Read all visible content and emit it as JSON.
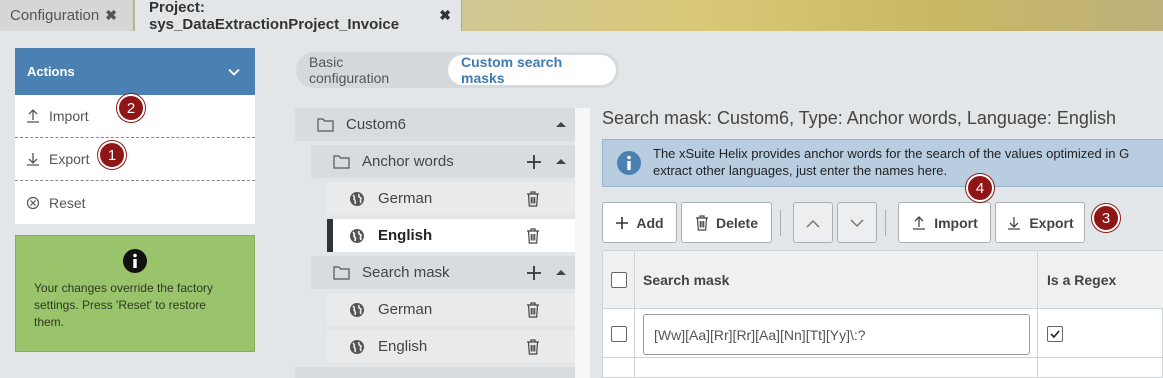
{
  "tabs": [
    {
      "label": "Configuration",
      "close": "✖"
    },
    {
      "label": "Project: sys_DataExtractionProject_Invoice",
      "close": "✖"
    }
  ],
  "actions": {
    "header": "Actions",
    "items": [
      {
        "label": "Import",
        "icon": "upload-icon",
        "badge": "2"
      },
      {
        "label": "Export",
        "icon": "download-icon",
        "badge": "1"
      },
      {
        "label": "Reset",
        "icon": "reset-icon"
      }
    ],
    "info_text": "Your changes override the factory settings. Press 'Reset' to restore them."
  },
  "mode_tabs": [
    {
      "label": "Basic configuration",
      "active": false
    },
    {
      "label": "Custom search masks",
      "active": true
    }
  ],
  "tree": {
    "root": "Custom6",
    "groups": [
      {
        "label": "Anchor words",
        "children": [
          "German",
          "English"
        ]
      },
      {
        "label": "Search mask",
        "children": [
          "German",
          "English"
        ]
      }
    ]
  },
  "main": {
    "title": "Search mask: Custom6, Type: Anchor words, Language: English",
    "info_line1": "The xSuite Helix provides anchor words for the search of the values optimized in G",
    "info_line2": "extract other languages, just enter the names here.",
    "toolbar": {
      "add": "Add",
      "delete": "Delete",
      "import": "Import",
      "export": "Export",
      "import_badge": "4",
      "export_badge": "3"
    },
    "grid": {
      "columns": [
        "Search mask",
        "Is a Regex"
      ],
      "rows": [
        {
          "search_mask": "[Ww][Aa][Rr][Rr][Aa][Nn][Tt][Yy]\\:?",
          "is_regex": true
        }
      ]
    }
  },
  "colors": {
    "accent": "#4a80b2",
    "badge": "#8f1616",
    "info_green": "#99c46b",
    "info_blue": "#b9cde1"
  }
}
